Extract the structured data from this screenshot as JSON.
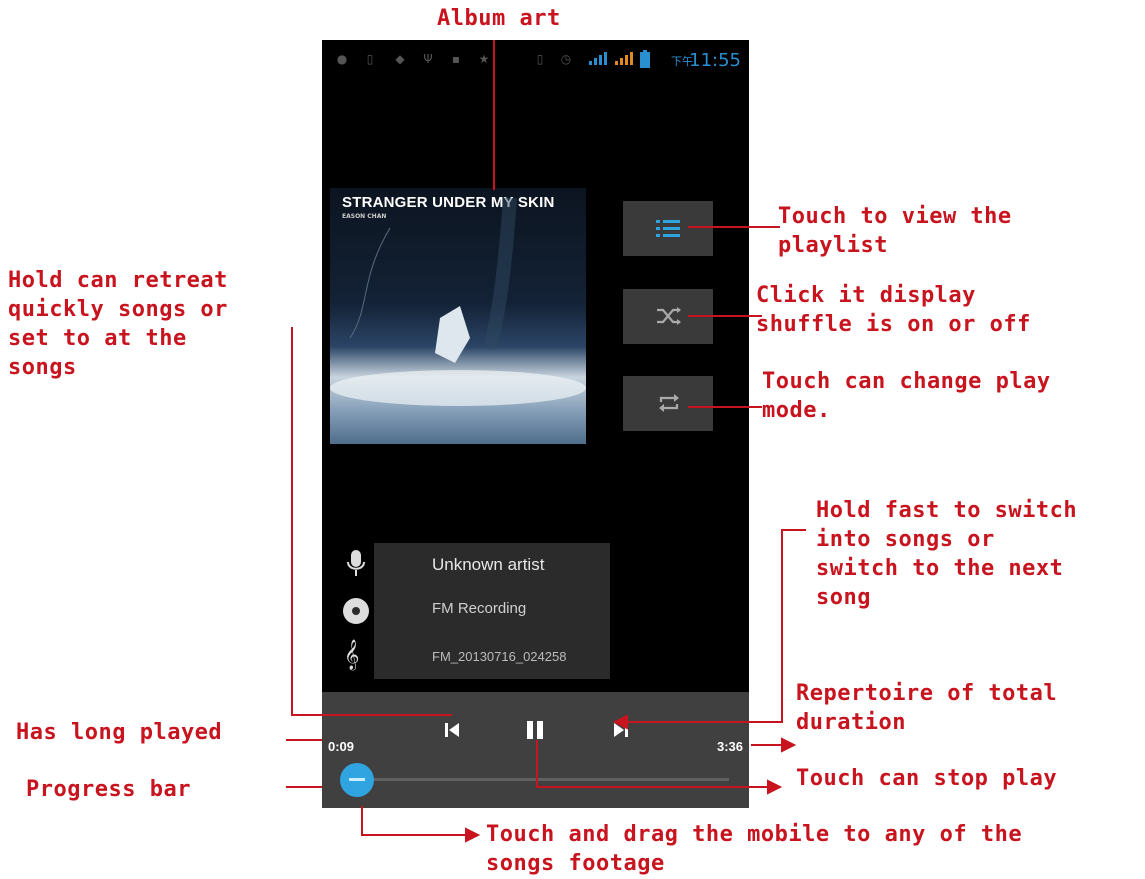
{
  "status_bar": {
    "ampm": "下午",
    "time": "11:55"
  },
  "album": {
    "title": "STRANGER UNDER MY SKIN",
    "artist_small": "EASON CHAN"
  },
  "side_buttons": {
    "playlist_icon": "playlist-icon",
    "shuffle_icon": "shuffle-icon",
    "repeat_icon": "repeat-icon"
  },
  "track_info": {
    "artist": "Unknown artist",
    "album": "FM Recording",
    "title": "FM_20130716_024258"
  },
  "playback": {
    "elapsed": "0:09",
    "total": "3:36",
    "progress_fraction": 0.04
  },
  "annotations": {
    "album_art": "Album art",
    "playlist": "Touch to view the\nplaylist",
    "shuffle": "Click it display\nshuffle is on or off",
    "play_mode": "Touch can change play\nmode.",
    "retreat": "Hold can retreat\nquickly songs or\nset to at the\nsongs",
    "forward": "Hold fast to switch\ninto songs or\nswitch to the next\nsong",
    "total_duration": "Repertoire of total\nduration",
    "long_played": "Has long played",
    "progress_bar": "Progress bar",
    "stop_play": "Touch can stop play",
    "drag": "Touch and drag the mobile to any of the\nsongs footage"
  },
  "colors": {
    "annotation": "#c8141e",
    "accent_blue": "#2fa4e0",
    "phone_bg": "#000000"
  }
}
